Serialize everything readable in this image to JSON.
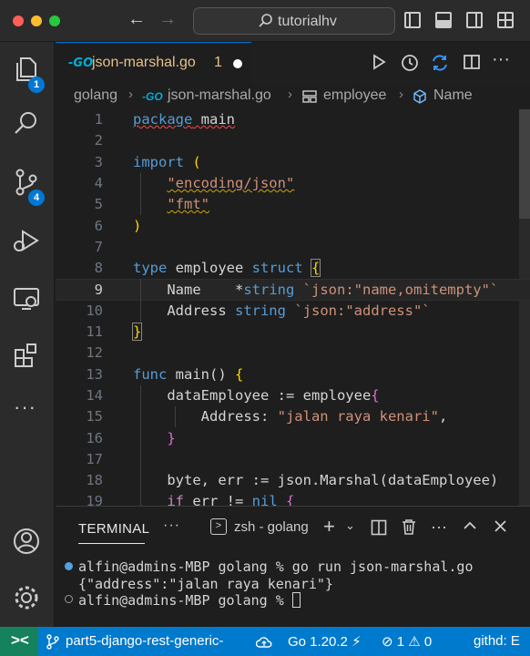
{
  "titlebar": {
    "search_text": "tutorialhv"
  },
  "activity": {
    "explorer_badge": "1",
    "scm_badge": "4"
  },
  "tab": {
    "icon": "-GO",
    "label": "json-marshal.go",
    "problems": "1"
  },
  "breadcrumb": {
    "folder": "golang",
    "file": "json-marshal.go",
    "struct": "employee",
    "field": "Name"
  },
  "editor": {
    "current_line": 9,
    "lines": [
      {
        "n": "1",
        "tokens": [
          [
            "kw squig",
            "package"
          ],
          [
            "plain squig",
            " main"
          ]
        ]
      },
      {
        "n": "2",
        "tokens": []
      },
      {
        "n": "3",
        "tokens": [
          [
            "kw",
            "import"
          ],
          [
            "plain",
            " "
          ],
          [
            "brace",
            "("
          ]
        ]
      },
      {
        "n": "4",
        "tokens": [
          [
            "plain",
            "    "
          ],
          [
            "str sq-yellow",
            "\"encoding/json\""
          ]
        ]
      },
      {
        "n": "5",
        "tokens": [
          [
            "plain",
            "    "
          ],
          [
            "str sq-yellow",
            "\"fmt\""
          ]
        ]
      },
      {
        "n": "6",
        "tokens": [
          [
            "brace",
            ")"
          ]
        ]
      },
      {
        "n": "7",
        "tokens": []
      },
      {
        "n": "8",
        "tokens": [
          [
            "kw",
            "type"
          ],
          [
            "plain",
            " employee "
          ],
          [
            "kw",
            "struct"
          ],
          [
            "plain",
            " "
          ],
          [
            "brace bracket-match",
            "{"
          ]
        ]
      },
      {
        "n": "9",
        "tokens": [
          [
            "plain",
            "    Name    *"
          ],
          [
            "kw",
            "string"
          ],
          [
            "plain",
            " "
          ],
          [
            "str",
            "`json:\"name,omitempty\"`"
          ]
        ]
      },
      {
        "n": "10",
        "tokens": [
          [
            "plain",
            "    Address "
          ],
          [
            "kw",
            "string"
          ],
          [
            "plain",
            " "
          ],
          [
            "str",
            "`json:\"address\"`"
          ]
        ]
      },
      {
        "n": "11",
        "tokens": [
          [
            "brace bracket-match",
            "}"
          ]
        ]
      },
      {
        "n": "12",
        "tokens": []
      },
      {
        "n": "13",
        "tokens": [
          [
            "kw",
            "func"
          ],
          [
            "plain",
            " main() "
          ],
          [
            "brace",
            "{"
          ]
        ]
      },
      {
        "n": "14",
        "tokens": [
          [
            "plain",
            "    dataEmployee := employee"
          ],
          [
            "brace2",
            "{"
          ]
        ]
      },
      {
        "n": "15",
        "tokens": [
          [
            "plain",
            "        Address: "
          ],
          [
            "str",
            "\"jalan raya kenari\""
          ],
          [
            "plain",
            ","
          ]
        ]
      },
      {
        "n": "16",
        "tokens": [
          [
            "plain",
            "    "
          ],
          [
            "brace2",
            "}"
          ]
        ]
      },
      {
        "n": "17",
        "tokens": []
      },
      {
        "n": "18",
        "tokens": [
          [
            "plain",
            "    byte, err := json.Marshal(dataEmployee)"
          ]
        ]
      },
      {
        "n": "19",
        "tokens": [
          [
            "plain",
            "    "
          ],
          [
            "kw2",
            "if"
          ],
          [
            "plain",
            " err != "
          ],
          [
            "kw",
            "nil"
          ],
          [
            "plain",
            " "
          ],
          [
            "brace2",
            "{"
          ]
        ]
      }
    ]
  },
  "panel": {
    "tab_label": "TERMINAL",
    "shell_label": "zsh - golang",
    "lines": [
      "alfin@admins-MBP golang % go run json-marshal.go",
      "{\"address\":\"jalan raya kenari\"}",
      "alfin@admins-MBP golang % "
    ]
  },
  "statusbar": {
    "branch": "part5-django-rest-generic-",
    "go_version": "Go 1.20.2",
    "errors": "1",
    "warnings": "0",
    "extra": "githd: E"
  },
  "colors": {
    "accent": "#007acc",
    "remote": "#16825d",
    "keyword": "#569cd6",
    "string": "#ce9178"
  }
}
